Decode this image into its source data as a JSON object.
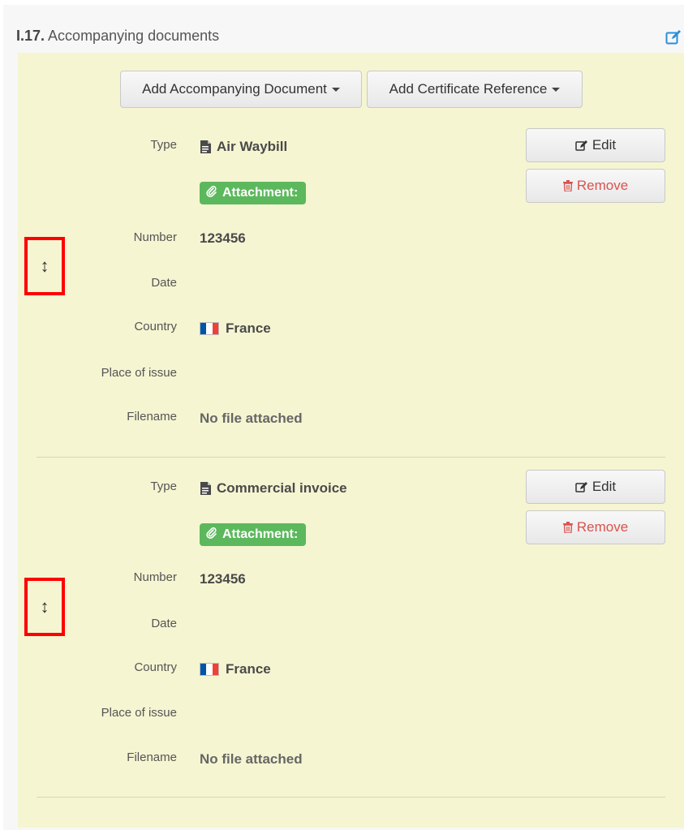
{
  "section": {
    "number": "I.17.",
    "title": "Accompanying documents",
    "edit_icon": "edit-icon"
  },
  "toolbar": {
    "add_document_label": "Add Accompanying Document",
    "add_certificate_label": "Add Certificate Reference"
  },
  "labels": {
    "type": "Type",
    "number": "Number",
    "date": "Date",
    "country": "Country",
    "place_of_issue": "Place of issue",
    "filename": "Filename"
  },
  "actions": {
    "edit": "Edit",
    "remove": "Remove"
  },
  "attachment_label": "Attachment:",
  "drag_handle_glyph": "↕",
  "documents": [
    {
      "type": "Air Waybill",
      "number": "123456",
      "date": "",
      "country": "France",
      "place_of_issue": "",
      "filename": "No file attached"
    },
    {
      "type": "Commercial invoice",
      "number": "123456",
      "date": "",
      "country": "France",
      "place_of_issue": "",
      "filename": "No file attached"
    }
  ],
  "colors": {
    "panel_bg": "#f5f5d2",
    "attachment_badge": "#5cb85c",
    "remove_text": "#d9534f",
    "drag_highlight": "#ff0000",
    "edit_icon": "#2a8fd8"
  }
}
